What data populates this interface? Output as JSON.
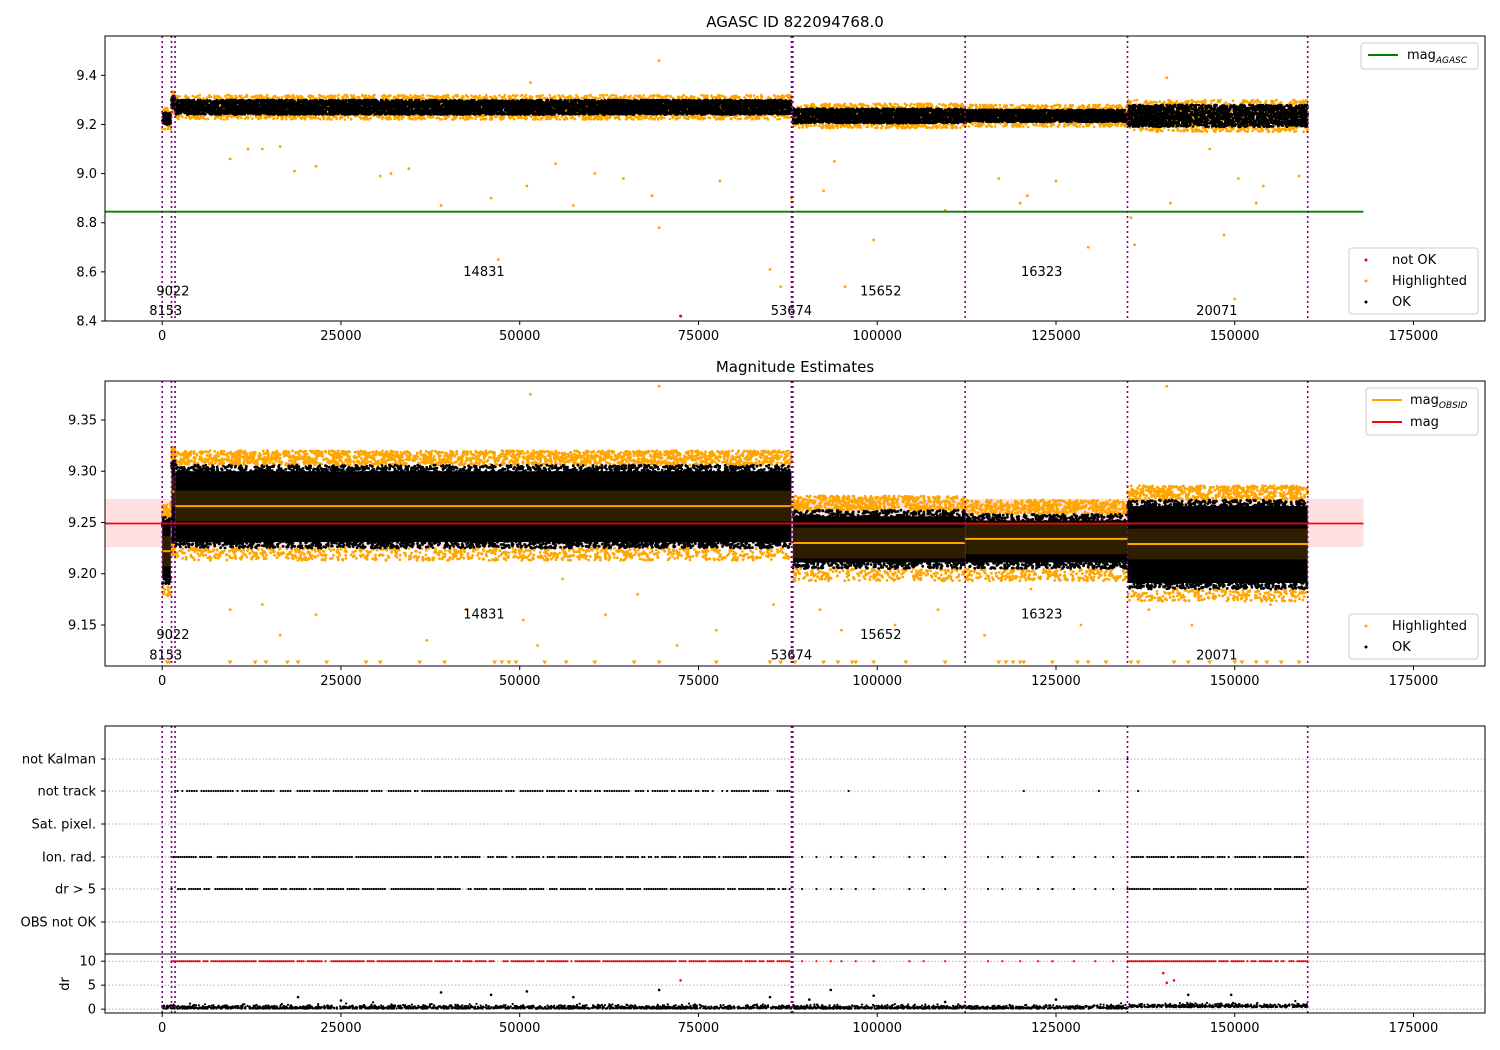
{
  "chart_data": [
    {
      "type": "scatter",
      "title": "AGASC ID 822094768.0",
      "xlim": [
        -8000,
        185000
      ],
      "ylim": [
        8.4,
        9.56
      ],
      "x_ticks": [
        0,
        25000,
        50000,
        75000,
        100000,
        125000,
        150000,
        175000
      ],
      "x_tick_labels": [
        "0",
        "25000",
        "50000",
        "75000",
        "100000",
        "125000",
        "150000",
        "175000"
      ],
      "y_ticks": [
        8.4,
        8.6,
        8.8,
        9.0,
        9.2,
        9.4
      ],
      "y_tick_labels": [
        "8.4",
        "8.6",
        "8.8",
        "9.0",
        "9.2",
        "9.4"
      ],
      "legend_upper": {
        "placement": "top-right",
        "entries": [
          {
            "label": "mag",
            "sub": "AGASC",
            "color": "#008000"
          }
        ]
      },
      "legend_lower": {
        "placement": "bottom-right",
        "entries": [
          {
            "label": "not OK",
            "color": "#ff0000"
          },
          {
            "label": "Highlighted",
            "color": "#ffa500"
          },
          {
            "label": "OK",
            "color": "#000000"
          }
        ]
      },
      "mag_agasc": 8.845,
      "mag_agasc_xrange": [
        -8000,
        168000
      ],
      "obsid_lines": [
        0,
        1300,
        1800,
        88000,
        88200,
        112300,
        135000,
        160200
      ],
      "obsid_labels": [
        {
          "text": "8153",
          "x": 500,
          "y": 8.44
        },
        {
          "text": "9022",
          "x": 1500,
          "y": 8.52
        },
        {
          "text": "14831",
          "x": 45000,
          "y": 8.6
        },
        {
          "text": "53674",
          "x": 88000,
          "y": 8.44
        },
        {
          "text": "15652",
          "x": 100500,
          "y": 8.52
        },
        {
          "text": "16323",
          "x": 123000,
          "y": 8.6
        },
        {
          "text": "20071",
          "x": 147500,
          "y": 8.44
        }
      ],
      "segments": [
        {
          "x0": 0,
          "x1": 1200,
          "center": 9.225,
          "band": 0.025
        },
        {
          "x0": 1300,
          "x1": 1800,
          "center": 9.29,
          "band": 0.025
        },
        {
          "x0": 1800,
          "x1": 88000,
          "center": 9.27,
          "band": 0.03
        },
        {
          "x0": 88200,
          "x1": 112300,
          "center": 9.235,
          "band": 0.03
        },
        {
          "x0": 112300,
          "x1": 135000,
          "center": 9.235,
          "band": 0.025
        },
        {
          "x0": 135000,
          "x1": 160200,
          "center": 9.235,
          "band": 0.045
        }
      ],
      "highlighted_outliers": [
        [
          9500,
          9.06
        ],
        [
          12000,
          9.1
        ],
        [
          14000,
          9.1
        ],
        [
          16500,
          9.11
        ],
        [
          18500,
          9.01
        ],
        [
          21500,
          9.03
        ],
        [
          30500,
          8.99
        ],
        [
          32000,
          9.0
        ],
        [
          34500,
          9.02
        ],
        [
          39000,
          8.87
        ],
        [
          46000,
          8.9
        ],
        [
          47000,
          8.65
        ],
        [
          51500,
          9.37
        ],
        [
          51000,
          8.95
        ],
        [
          55000,
          9.04
        ],
        [
          57500,
          8.87
        ],
        [
          60500,
          9.0
        ],
        [
          64500,
          8.98
        ],
        [
          68500,
          8.91
        ],
        [
          69500,
          9.46
        ],
        [
          69500,
          8.78
        ],
        [
          78000,
          8.97
        ],
        [
          85000,
          8.61
        ],
        [
          86500,
          8.54
        ],
        [
          88000,
          8.9
        ],
        [
          92500,
          8.93
        ],
        [
          94000,
          9.05
        ],
        [
          99500,
          8.73
        ],
        [
          95500,
          8.54
        ],
        [
          109500,
          8.85
        ],
        [
          117000,
          8.98
        ],
        [
          120000,
          8.88
        ],
        [
          121000,
          8.91
        ],
        [
          125000,
          8.97
        ],
        [
          129500,
          8.7
        ],
        [
          135500,
          8.82
        ],
        [
          136000,
          8.71
        ],
        [
          140500,
          9.39
        ],
        [
          141000,
          8.88
        ],
        [
          146500,
          9.1
        ],
        [
          150500,
          8.98
        ],
        [
          148500,
          8.75
        ],
        [
          150000,
          8.49
        ],
        [
          153000,
          8.88
        ],
        [
          154000,
          8.95
        ],
        [
          159000,
          8.99
        ]
      ],
      "notok_points": [
        [
          72500,
          8.42
        ]
      ]
    },
    {
      "type": "scatter",
      "title": "Magnitude Estimates",
      "xlim": [
        -8000,
        185000
      ],
      "ylim": [
        9.11,
        9.388
      ],
      "x_ticks": [
        0,
        25000,
        50000,
        75000,
        100000,
        125000,
        150000,
        175000
      ],
      "x_tick_labels": [
        "0",
        "25000",
        "50000",
        "75000",
        "100000",
        "125000",
        "150000",
        "175000"
      ],
      "y_ticks": [
        9.15,
        9.2,
        9.25,
        9.3,
        9.35
      ],
      "y_tick_labels": [
        "9.15",
        "9.20",
        "9.25",
        "9.30",
        "9.35"
      ],
      "legend_upper": {
        "placement": "top-right",
        "entries": [
          {
            "label": "mag",
            "sub": "OBSID",
            "color": "#ffa500"
          },
          {
            "label": "mag",
            "sub": "",
            "color": "#ff0000"
          }
        ]
      },
      "legend_lower": {
        "placement": "bottom-right",
        "entries": [
          {
            "label": "Highlighted",
            "color": "#ffa500"
          },
          {
            "label": "OK",
            "color": "#000000"
          }
        ]
      },
      "mag": 9.249,
      "mag_band": [
        9.226,
        9.273
      ],
      "mag_xrange": [
        -8000,
        168000
      ],
      "obsid_lines": [
        0,
        1300,
        1800,
        88000,
        88200,
        112300,
        135000,
        160200
      ],
      "obsid_labels": [
        {
          "text": "8153",
          "x": 500,
          "y": 9.12
        },
        {
          "text": "9022",
          "x": 1500,
          "y": 9.14
        },
        {
          "text": "14831",
          "x": 45000,
          "y": 9.16
        },
        {
          "text": "53674",
          "x": 88000,
          "y": 9.12
        },
        {
          "text": "15652",
          "x": 100500,
          "y": 9.14
        },
        {
          "text": "16323",
          "x": 123000,
          "y": 9.16
        },
        {
          "text": "20071",
          "x": 147500,
          "y": 9.12
        }
      ],
      "segments": [
        {
          "x0": 0,
          "x1": 1200,
          "mean": 9.222,
          "lo": 9.19,
          "hi": 9.255
        },
        {
          "x0": 1300,
          "x1": 1800,
          "mean": 9.28,
          "lo": 9.23,
          "hi": 9.31
        },
        {
          "x0": 1800,
          "x1": 88000,
          "mean": 9.266,
          "lo": 9.225,
          "hi": 9.306
        },
        {
          "x0": 88200,
          "x1": 112300,
          "mean": 9.23,
          "lo": 9.205,
          "hi": 9.262
        },
        {
          "x0": 112300,
          "x1": 135000,
          "mean": 9.234,
          "lo": 9.205,
          "hi": 9.258
        },
        {
          "x0": 135000,
          "x1": 160200,
          "mean": 9.229,
          "lo": 9.185,
          "hi": 9.272
        }
      ],
      "highlighted_outliers": [
        [
          51500,
          9.375
        ],
        [
          69500,
          9.383
        ],
        [
          140500,
          9.383
        ],
        [
          9500,
          9.165
        ],
        [
          14000,
          9.17
        ],
        [
          16500,
          9.14
        ],
        [
          21500,
          9.16
        ],
        [
          37000,
          9.135
        ],
        [
          42500,
          9.165
        ],
        [
          50500,
          9.155
        ],
        [
          52500,
          9.13
        ],
        [
          56000,
          9.195
        ],
        [
          62000,
          9.16
        ],
        [
          66500,
          9.18
        ],
        [
          72000,
          9.13
        ],
        [
          77500,
          9.145
        ],
        [
          85500,
          9.17
        ],
        [
          92000,
          9.165
        ],
        [
          95000,
          9.145
        ],
        [
          102500,
          9.15
        ],
        [
          108500,
          9.165
        ],
        [
          115000,
          9.14
        ],
        [
          121500,
          9.185
        ],
        [
          128500,
          9.15
        ],
        [
          138000,
          9.165
        ],
        [
          144000,
          9.15
        ],
        [
          155000,
          9.17
        ]
      ],
      "lower_limit_markers": [
        700,
        1000,
        9500,
        13000,
        14500,
        17500,
        19000,
        23000,
        28500,
        30500,
        36000,
        39500,
        46500,
        47500,
        48500,
        49500,
        53500,
        56500,
        60500,
        66000,
        69500,
        77500,
        85000,
        86500,
        88500,
        92500,
        94500,
        96500,
        97000,
        99500,
        104000,
        109500,
        117000,
        118000,
        119000,
        120000,
        120500,
        124500,
        128000,
        129500,
        132000,
        135500,
        136500,
        141500,
        143500,
        146500,
        150000,
        151000,
        153000,
        154500,
        156500,
        159000
      ]
    },
    {
      "type": "scatter",
      "title": "",
      "xlim": [
        -8000,
        185000
      ],
      "x_ticks": [
        0,
        25000,
        50000,
        75000,
        100000,
        125000,
        150000,
        175000
      ],
      "x_tick_labels": [
        "0",
        "25000",
        "50000",
        "75000",
        "100000",
        "125000",
        "150000",
        "175000"
      ],
      "categories": [
        "not Kalman",
        "not track",
        "Sat. pixel.",
        "Ion. rad.",
        "dr > 5",
        "OBS not OK"
      ],
      "dr_ylabel": "dr",
      "dr_ylim": [
        -0.8,
        11.5
      ],
      "dr_ticks": [
        0,
        5,
        10
      ],
      "dr_tick_labels": [
        "0",
        "5",
        "10"
      ],
      "obsid_lines": [
        0,
        1300,
        1800,
        88000,
        88200,
        112300,
        135000,
        160200
      ],
      "flag_ranges": {
        "not track": [
          [
            1800,
            88000
          ]
        ],
        "Ion. rad.": [
          [
            1300,
            88000
          ],
          [
            135000,
            160200
          ]
        ],
        "dr > 5": [
          [
            1300,
            88000
          ],
          [
            135000,
            160200
          ]
        ],
        "dr10": [
          [
            1300,
            88000
          ],
          [
            135000,
            160200
          ]
        ]
      },
      "sparse_flags": {
        "not Kalman": [
          135000
        ],
        "not track": [
          96000,
          120500,
          131000,
          136500
        ],
        "Ion. rad.": [
          89500,
          91500,
          93500,
          95000,
          97000,
          99500,
          104500,
          106500,
          109500,
          115500,
          117500,
          120000,
          122500,
          124500,
          127500,
          130500,
          133000
        ],
        "dr > 5": [
          89500,
          91500,
          93500,
          95000,
          97000,
          99500,
          104500,
          106500,
          109500,
          115500,
          117500,
          120000,
          122500,
          124500,
          127500,
          130500,
          133000
        ],
        "dr10": [
          89500,
          91500,
          93500,
          95000,
          97000,
          99500,
          104500,
          106500,
          109500,
          115500,
          117500,
          120000,
          122500,
          124500,
          127500,
          130500,
          133000
        ]
      },
      "dr_outliers": [
        [
          19000,
          2.5
        ],
        [
          25000,
          1.8
        ],
        [
          39000,
          3.5
        ],
        [
          46000,
          3.0
        ],
        [
          51000,
          3.7
        ],
        [
          57500,
          2.5
        ],
        [
          69500,
          4.0
        ],
        [
          72500,
          6.0
        ],
        [
          85000,
          2.5
        ],
        [
          90500,
          2.0
        ],
        [
          93500,
          4.0
        ],
        [
          99500,
          2.8
        ],
        [
          109500,
          1.5
        ],
        [
          125000,
          2.0
        ],
        [
          140000,
          7.5
        ],
        [
          140500,
          5.5
        ],
        [
          141500,
          6.0
        ],
        [
          143500,
          3.0
        ],
        [
          149500,
          3.0
        ]
      ]
    }
  ]
}
